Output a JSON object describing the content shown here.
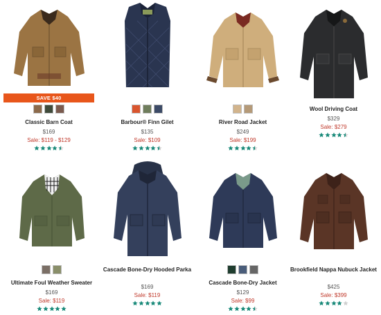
{
  "colors": {
    "accent_orange": "#e8561b",
    "sale_red": "#c0392b",
    "star_teal": "#1a8a7a",
    "star_empty": "#cfcfcf"
  },
  "products": [
    {
      "name": "Classic Barn Coat",
      "price": "$169",
      "sale": "Sale: $119 - $129",
      "badge": "SAVE $40",
      "rating": 4.5,
      "swatches": [
        "#8c6a4b",
        "#3f4a3a",
        "#7a5a4e"
      ]
    },
    {
      "name": "Barbour® Finn Gilet",
      "price": "$135",
      "sale": "Sale: $109",
      "rating": 4.5,
      "swatches": [
        "#d9552e",
        "#6f7d5c",
        "#3c4a66"
      ]
    },
    {
      "name": "River Road Jacket",
      "price": "$249",
      "sale": "Sale: $199",
      "rating": 4.5,
      "swatches": [
        "#d2b48c",
        "#b59a78"
      ]
    },
    {
      "name": "Wool Driving Coat",
      "price": "$329",
      "sale": "Sale: $279",
      "rating": 4.5,
      "swatches": []
    },
    {
      "name": "Ultimate Foul Weather Sweater",
      "price": "$169",
      "sale": "Sale: $119",
      "rating": 5,
      "swatches": [
        "#7b6f66",
        "#8a8f6a"
      ]
    },
    {
      "name": "Cascade Bone-Dry Hooded Parka",
      "price": "$169",
      "sale": "Sale: $119",
      "rating": 5,
      "swatches": []
    },
    {
      "name": "Cascade Bone-Dry Jacket",
      "price": "$129",
      "sale": "Sale: $99",
      "rating": 4.5,
      "swatches": [
        "#1f3d2f",
        "#4a5d7a",
        "#666666"
      ]
    },
    {
      "name": "Brookfield Nappa Nubuck Jacket",
      "price": "$425",
      "sale": "Sale: $399",
      "rating": 4,
      "swatches": []
    }
  ]
}
